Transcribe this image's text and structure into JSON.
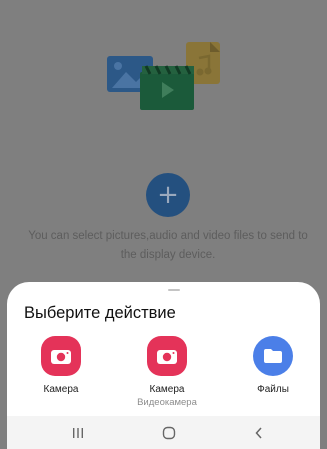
{
  "background": {
    "hint_text": "You can select pictures,audio and video files to send to the display device.",
    "add_icon": "plus-icon",
    "colors": {
      "overlay": "#7f7f7f",
      "add_button": "#24507f"
    }
  },
  "sheet": {
    "title": "Выберите действие",
    "apps": [
      {
        "label": "Камера",
        "sublabel": "",
        "icon": "camera-icon",
        "color": "#e43359"
      },
      {
        "label": "Камера",
        "sublabel": "Видеокамера",
        "icon": "camera-icon",
        "color": "#e43359"
      },
      {
        "label": "Файлы",
        "sublabel": "",
        "icon": "folder-icon",
        "color": "#4b7fe8"
      }
    ]
  },
  "navbar": {
    "icons": [
      "recent-apps-icon",
      "home-icon",
      "back-icon"
    ]
  }
}
